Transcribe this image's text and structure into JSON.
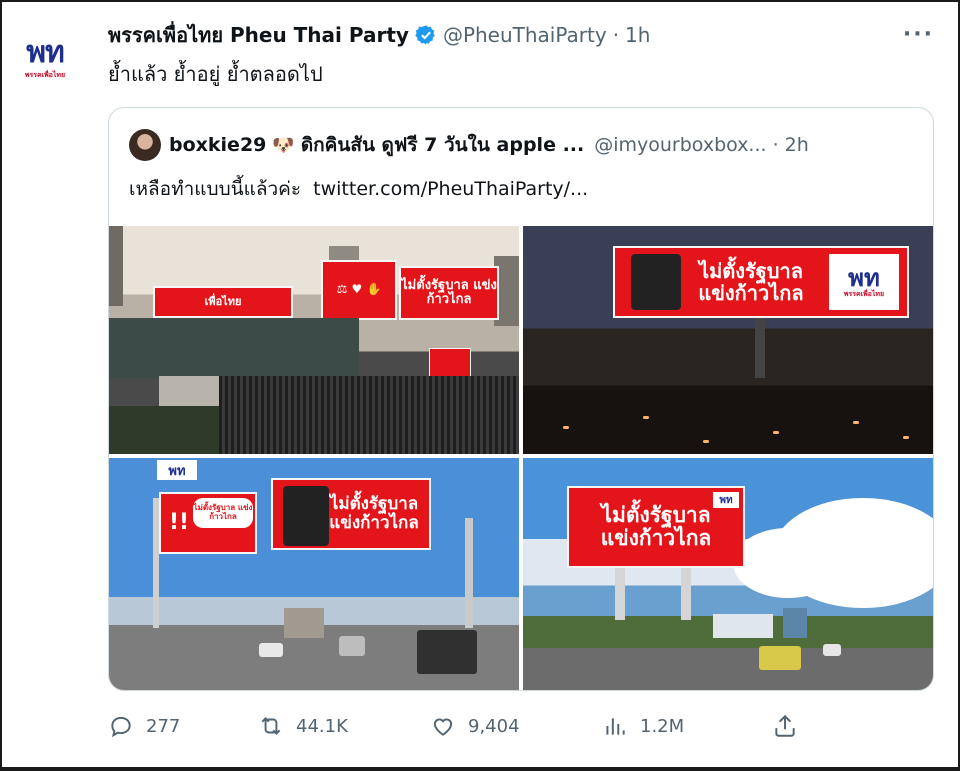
{
  "tweet": {
    "author_name": "พรรคเพื่อไทย Pheu Thai Party",
    "handle": "@PheuThaiParty",
    "separator": "·",
    "time": "1h",
    "more_label": "···",
    "text": "ย้ำแล้ว ย้ำอยู่ ย้ำตลอดไป",
    "avatar": {
      "mark": "พท",
      "sub": "พรรคเพื่อไทย"
    }
  },
  "quote": {
    "author_name": "boxkie29",
    "emoji": "🐶",
    "display_suffix": "ดิกคินสัน ดูฟรี 7 วันใน apple ...",
    "handle": "@imyourboxbox...",
    "separator": "·",
    "time": "2h",
    "text": "เหลือทำแบบนี้แล้วค่ะ",
    "link": "twitter.com/PheuThaiParty/...",
    "photos": {
      "p1": {
        "small_board": "เพื่อไทย",
        "big_board": "ไม่ตั้งรัฐบาล แข่งก้าวไกล"
      },
      "p2": {
        "board": "ไม่ตั้งรัฐบาล แข่งก้าวไกล",
        "logo": "พท",
        "logo_sub": "พรรคเพื่อไทย"
      },
      "p3": {
        "board": "ไม่ตั้งรัฐบาล แข่งก้าวไกล",
        "bubble": "ไม่ตั้งรัฐบาล แข่งก้าวไกล",
        "sign": "พท"
      },
      "p4": {
        "board": "ไม่ตั้งรัฐบาล แข่งก้าวไกล",
        "logo": "พท"
      }
    }
  },
  "actions": {
    "replies": "277",
    "retweets": "44.1K",
    "likes": "9,404",
    "views": "1.2M"
  },
  "colors": {
    "brand_red": "#e3151a",
    "verified_blue": "#1d9bf0",
    "muted_text": "#536471",
    "party_blue": "#1f2f8f"
  }
}
